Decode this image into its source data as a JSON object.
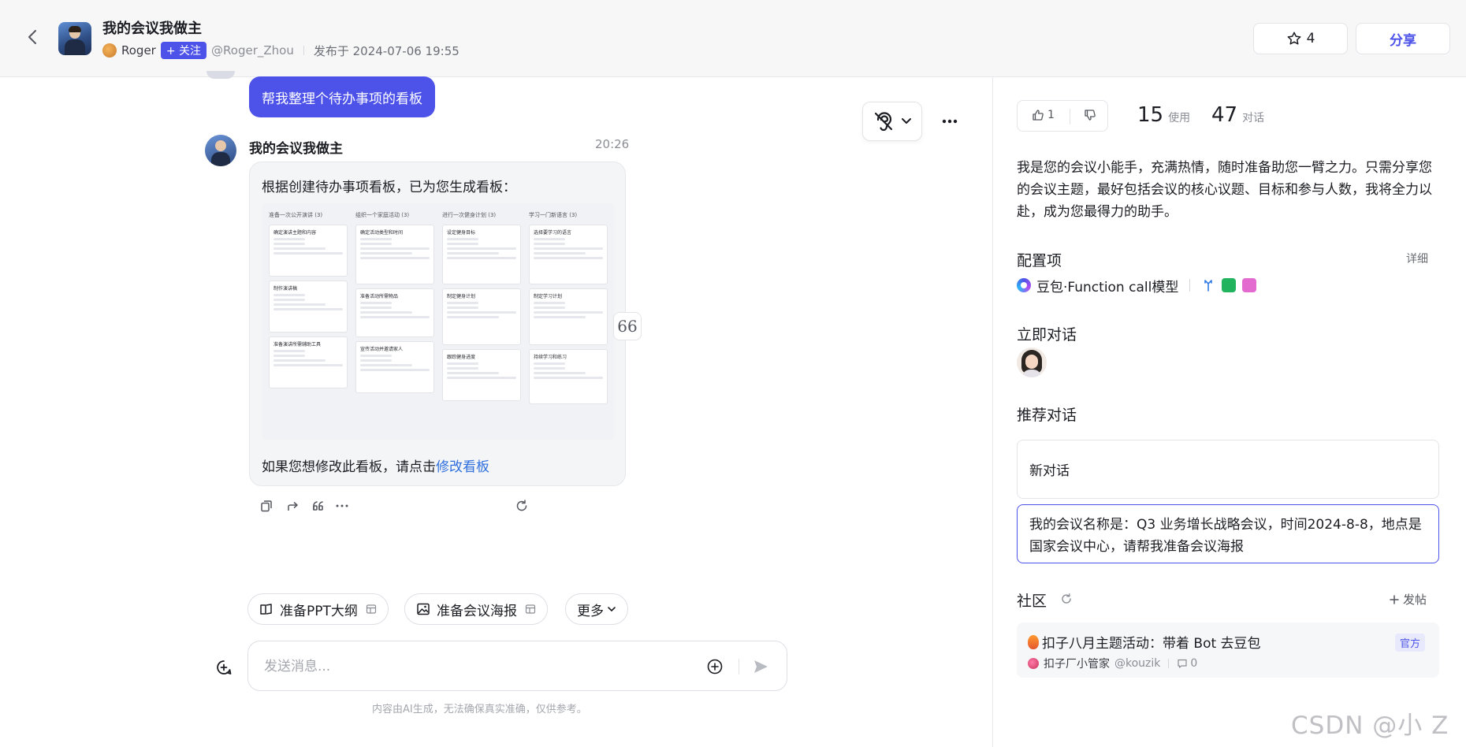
{
  "header": {
    "title": "我的会议我做主",
    "author_name": "Roger",
    "follow_label": "+ 关注",
    "author_handle": "@Roger_Zhou",
    "publish_text": "发布于 2024-07-06 19:55",
    "star_count": "4",
    "share_label": "分享"
  },
  "chat": {
    "user_message": "帮我整理个待办事项的看板",
    "bot_name": "我的会议我做主",
    "bot_time": "20:26",
    "bot_intro": "根据创建待办事项看板，已为您生成看板：",
    "bot_outro_prefix": "如果您想修改此看板，请点击",
    "bot_outro_link": "修改看板",
    "kanban": {
      "columns": [
        {
          "title": "准备一次公开演讲 (3)",
          "cards": [
            "确定演讲主题和内容",
            "制作演讲稿",
            "准备演讲所需辅助工具"
          ]
        },
        {
          "title": "组织一个家庭活动 (3)",
          "cards": [
            "确定活动类型和时间",
            "准备活动所需物品",
            "宣传活动并邀请家人"
          ]
        },
        {
          "title": "进行一次健身计划 (3)",
          "cards": [
            "设定健身目标",
            "制定健身计划",
            "跟踪健身进度"
          ]
        },
        {
          "title": "学习一门新语言 (3)",
          "cards": [
            "选择要学习的语言",
            "制定学习计划",
            "持续学习和练习"
          ]
        }
      ]
    },
    "quote_glyph": "66"
  },
  "suggestions": [
    {
      "label": "准备PPT大纲"
    },
    {
      "label": "准备会议海报"
    },
    {
      "label": "更多"
    }
  ],
  "input": {
    "placeholder": "发送消息..."
  },
  "disclaimer": "内容由AI生成，无法确保真实准确，仅供参考。",
  "panel": {
    "like_count": "1",
    "usage_count": "15",
    "usage_label": "使用",
    "dialog_count": "47",
    "dialog_label": "对话",
    "description": "我是您的会议小能手，充满热情，随时准备助您一臂之力。只需分享您的会议主题，最好包括会议的核心议题、目标和参与人数，我将全力以赴，成为您最得力的助手。",
    "config_title": "配置项",
    "detail_label": "详细",
    "model_name": "豆包·Function call模型",
    "plugin_colors": [
      "#2f7ae5",
      "#22b35e",
      "#e36bd0"
    ],
    "quick_title": "立即对话",
    "recommend_title": "推荐对话",
    "recommendations": [
      "新对话",
      "我的会议名称是：Q3 业务增长战略会议，时间2024-8-8，地点是国家会议中心，请帮我准备会议海报"
    ],
    "community_title": "社区",
    "post_label": "发帖",
    "post": {
      "title": "扣子八月主题活动：带着 Bot 去豆包",
      "badge": "官方",
      "author": "扣子厂小管家",
      "handle": "@kouzik",
      "comments": "0"
    }
  },
  "watermark": "CSDN @小 Z",
  "colors": {
    "accent": "#4d53e8",
    "link": "#2f6fdd"
  }
}
